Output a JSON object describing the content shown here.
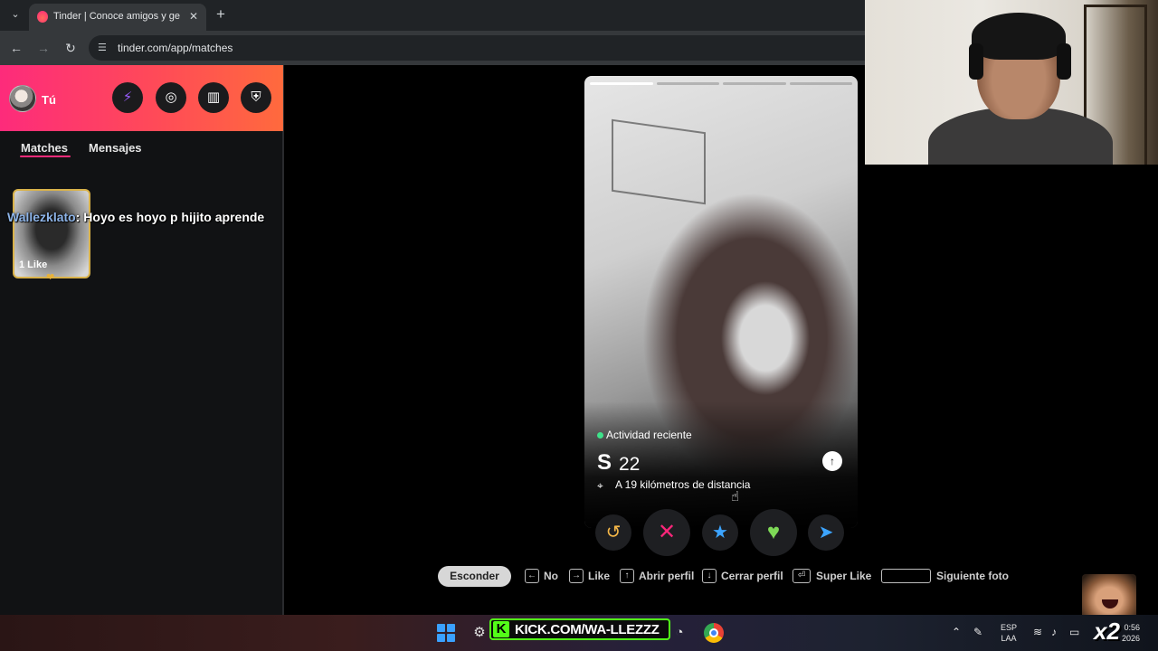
{
  "browser": {
    "tab_title": "Tinder | Conoce amigos y gente nueva",
    "url": "tinder.com/app/matches",
    "icons": {
      "tab_list": "chevron-down-icon",
      "close": "close-icon",
      "new_tab": "plus-icon",
      "back": "arrow-left-icon",
      "forward": "arrow-right-icon",
      "reload": "reload-icon",
      "site_info": "tune-icon"
    }
  },
  "sidebar": {
    "user_label": "Tú",
    "header_buttons": [
      "bolt-icon",
      "compass-icon",
      "briefcase-icon",
      "shield-icon"
    ],
    "tabs": [
      {
        "label": "Matches",
        "active": true
      },
      {
        "label": "Mensajes",
        "active": false
      }
    ],
    "likes_card": {
      "label": "1 Like"
    }
  },
  "chat_overlay": {
    "user": "Wallezklato",
    "separator": ":",
    "message": "Hoyo es hoyo p hijito aprende"
  },
  "profile": {
    "photo_count": 4,
    "active_photo_index": 0,
    "activity": "Actividad reciente",
    "name": "S",
    "age": "22",
    "distance": "A 19 kilómetros de distancia",
    "accent_active": "#3ee28a"
  },
  "actions": [
    {
      "name": "rewind",
      "icon": "↺",
      "color": "#f5b748"
    },
    {
      "name": "nope",
      "icon": "✕",
      "color": "#fd267a"
    },
    {
      "name": "super-like",
      "icon": "★",
      "color": "#3ca4ff"
    },
    {
      "name": "like",
      "icon": "♥",
      "color": "#7ed957"
    },
    {
      "name": "boost",
      "icon": "➤",
      "color": "#3ca4ff"
    }
  ],
  "hints": {
    "hide": "Esconder",
    "no": "No",
    "like": "Like",
    "open_profile": "Abrir perfil",
    "close_profile": "Cerrar perfil",
    "super_like": "Super Like",
    "next_photo": "Siguiente foto"
  },
  "taskbar": {
    "kick": "KICK.COM/WA-LLEZZZ",
    "kick_logo": "K",
    "lang_top": "ESP",
    "lang_bottom": "LAA",
    "time": "0:56",
    "date": "2026",
    "multiplier": "x2"
  },
  "colors": {
    "brand_gradient_start": "#fd2b7b",
    "brand_gradient_end": "#ff6a3d",
    "kick_green": "#53fc18"
  }
}
